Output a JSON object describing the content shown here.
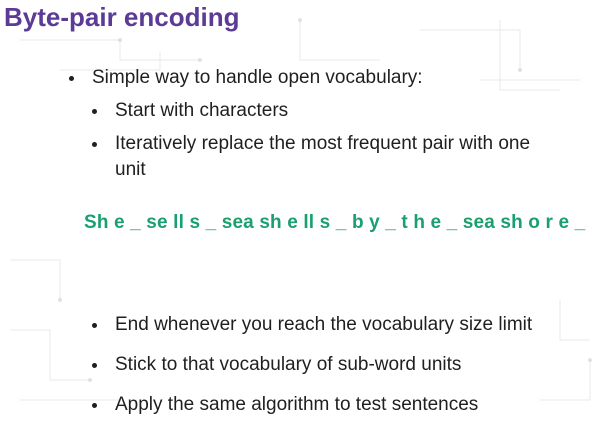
{
  "slide": {
    "title": "Byte-pair encoding",
    "bullets": [
      {
        "level": 1,
        "text": "Simple way to handle open vocabulary:"
      },
      {
        "level": 2,
        "text": "Start with characters"
      },
      {
        "level": 2,
        "text": "Iteratively replace the most frequent pair with one"
      },
      {
        "level": 2,
        "text": "unit",
        "continuation": true
      },
      {
        "level": 2,
        "text": "End whenever you reach the vocabulary size limit"
      },
      {
        "level": 2,
        "text": "Stick to that vocabulary of sub-word units"
      },
      {
        "level": 2,
        "text": "Apply the same algorithm to test sentences"
      }
    ],
    "example_sentence": "Sh e _ se ll s _ sea sh e ll s _ b y _ t h e _ sea sh o r e _",
    "colors": {
      "title": "#5b3b96",
      "body_text": "#1f1f1f",
      "example_text": "#1aa06e",
      "background": "#ffffff"
    }
  }
}
